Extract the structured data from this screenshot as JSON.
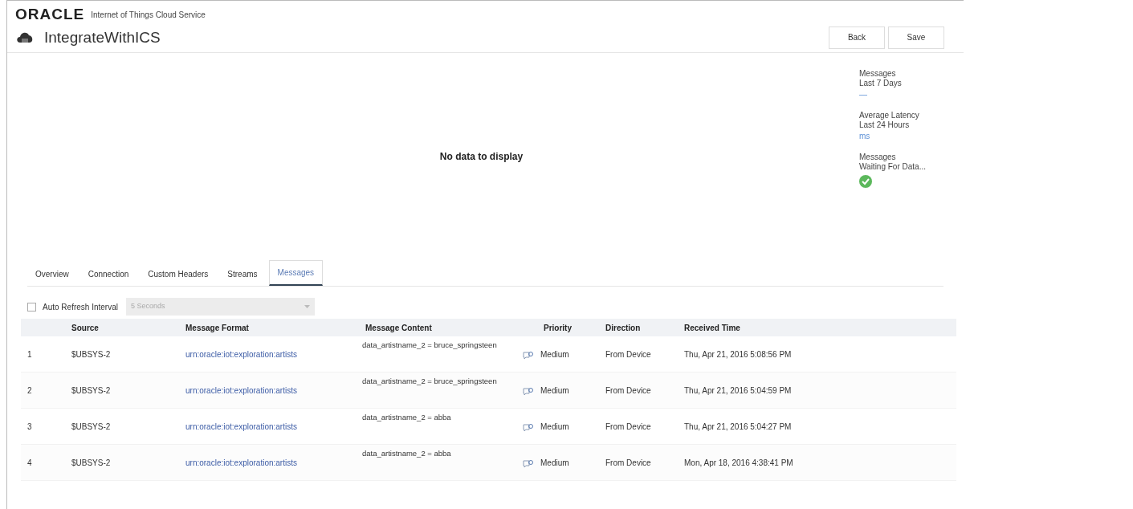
{
  "header": {
    "brand": "ORACLE",
    "product": "Internet of Things Cloud Service",
    "title": "IntegrateWithICS",
    "buttons": [
      "Back",
      "Save"
    ]
  },
  "chart_area": {
    "empty_text": "No data to display"
  },
  "metrics": [
    {
      "kind": "text",
      "label": "Messages",
      "sub": "Last 7 Days",
      "value": "—"
    },
    {
      "kind": "text",
      "label": "Average Latency",
      "sub": "Last 24 Hours",
      "value": "ms"
    },
    {
      "kind": "status",
      "label": "Messages",
      "sub": "Waiting For Data...",
      "ok": true
    }
  ],
  "tabs": [
    {
      "label": "Overview",
      "selected": false
    },
    {
      "label": "Connection",
      "selected": false
    },
    {
      "label": "Custom Headers",
      "selected": false
    },
    {
      "label": "Streams",
      "selected": false
    },
    {
      "label": "Messages",
      "selected": true
    }
  ],
  "auto_refresh": {
    "label": "Auto Refresh Interval",
    "checked": false,
    "interval": "5 Seconds",
    "disabled": true
  },
  "table": {
    "columns": [
      "",
      "Source",
      "Message Format",
      "Message Content",
      "Priority",
      "Direction",
      "Received Time"
    ],
    "rows": [
      {
        "index": "1",
        "source": "$UBSYS-2",
        "format": "urn:oracle:iot:exploration:artists",
        "content": "data_artistname_2 = bruce_springsteen",
        "priority": "Medium",
        "direction": "From Device",
        "time": "Thu, Apr 21, 2016 5:08:56 PM"
      },
      {
        "index": "2",
        "source": "$UBSYS-2",
        "format": "urn:oracle:iot:exploration:artists",
        "content": "data_artistname_2 = bruce_springsteen",
        "priority": "Medium",
        "direction": "From Device",
        "time": "Thu, Apr 21, 2016 5:04:59 PM"
      },
      {
        "index": "3",
        "source": "$UBSYS-2",
        "format": "urn:oracle:iot:exploration:artists",
        "content": "data_artistname_2 = abba",
        "priority": "Medium",
        "direction": "From Device",
        "time": "Thu, Apr 21, 2016 5:04:27 PM"
      },
      {
        "index": "4",
        "source": "$UBSYS-2",
        "format": "urn:oracle:iot:exploration:artists",
        "content": "data_artistname_2 = abba",
        "priority": "Medium",
        "direction": "From Device",
        "time": "Mon, Apr 18, 2016 4:38:41 PM"
      }
    ]
  }
}
